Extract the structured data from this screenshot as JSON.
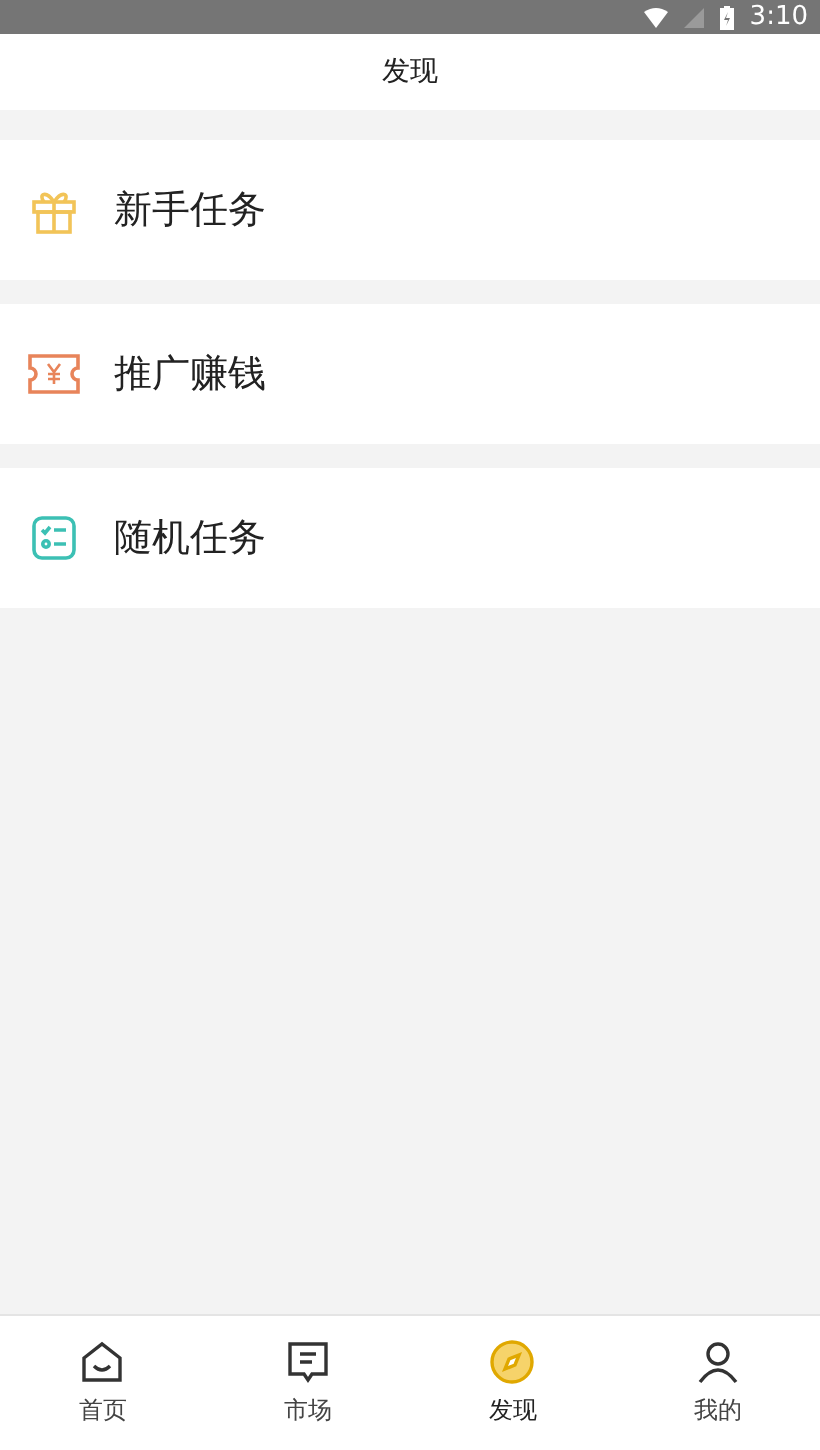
{
  "status_bar": {
    "time": "3:10"
  },
  "header": {
    "title": "发现"
  },
  "menu": [
    {
      "label": "新手任务",
      "kind": "gift"
    },
    {
      "label": "推广赚钱",
      "kind": "ticket"
    },
    {
      "label": "随机任务",
      "kind": "checklist"
    }
  ],
  "tab_bar": [
    {
      "label": "首页",
      "kind": "home",
      "selected": false
    },
    {
      "label": "市场",
      "kind": "market",
      "selected": false
    },
    {
      "label": "发现",
      "kind": "discover",
      "selected": true
    },
    {
      "label": "我的",
      "kind": "profile",
      "selected": false
    }
  ]
}
